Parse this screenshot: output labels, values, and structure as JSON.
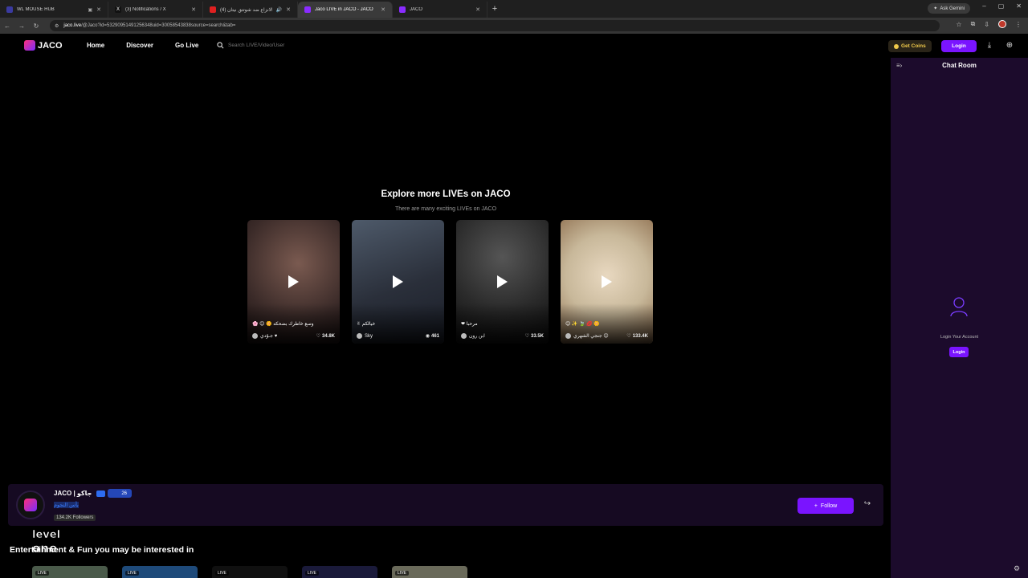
{
  "browser": {
    "tabs": [
      {
        "title": "WL MOUSE HUB",
        "color": "#3a3aa0"
      },
      {
        "title": "(3) Notifications / X",
        "color": "#111111"
      },
      {
        "title": "(4) ليم الانزاع ضد شوتتق نيتان",
        "color": "#e02020"
      },
      {
        "title": "Jaco LIVE in JACO - JACO",
        "color": "#8a2cff",
        "active": true
      },
      {
        "title": "JACO",
        "color": "#8a2cff"
      }
    ],
    "ask_gemini": "Ask Gemini",
    "url_host": "jaco.live",
    "url_path": "/@Jaco?id=53290951491256348uid=30058543838source=search&tab="
  },
  "header": {
    "logo": "JACO",
    "nav": [
      "Home",
      "Discover",
      "Go Live"
    ],
    "search_placeholder": "Search LIVE/Video/User",
    "get_coins": "Get Coins",
    "login": "Login"
  },
  "explore": {
    "title": "Explore more LIVEs on JACO",
    "subtitle": "There are many exciting LIVEs on JACO",
    "cards": [
      {
        "caption": "وسع خاطرك بضحكه 🌼 😊 🌸",
        "user": "جـوُدي ♥",
        "views": "34.8K",
        "colors": [
          "#3a2a28",
          "#7a5a50"
        ]
      },
      {
        "caption": "خيالكم ✌",
        "user": "Sky",
        "views": "461",
        "colors": [
          "#2a2f3a",
          "#4e5a6a"
        ]
      },
      {
        "caption": "مرحبا ❤",
        "user": "ابن رون",
        "views": "33.5K",
        "colors": [
          "#1e1e1e",
          "#444444"
        ]
      },
      {
        "caption": "😊 ✨ 🍃 💋 🌼",
        "user": "جنجي الشهري 😊",
        "views": "133.4K",
        "colors": [
          "#c8b89a",
          "#8a6a4a"
        ]
      }
    ]
  },
  "chat": {
    "title": "Chat Room",
    "login_prompt": "Login Your Account",
    "login_button": "Login"
  },
  "streamer": {
    "name": "JACO | جاكو",
    "level": "26",
    "subtitle": "بأس النجوم",
    "followers": "134.2K Followers",
    "follow_button": "Follow"
  },
  "section": {
    "title": "Entertainment & Fun you may be interested in",
    "live_tag": "LIVE",
    "thumbs": [
      "#4a5a4a",
      "#1e4a7a",
      "#101010",
      "#1a1a3a",
      "#6a6a5a"
    ]
  }
}
